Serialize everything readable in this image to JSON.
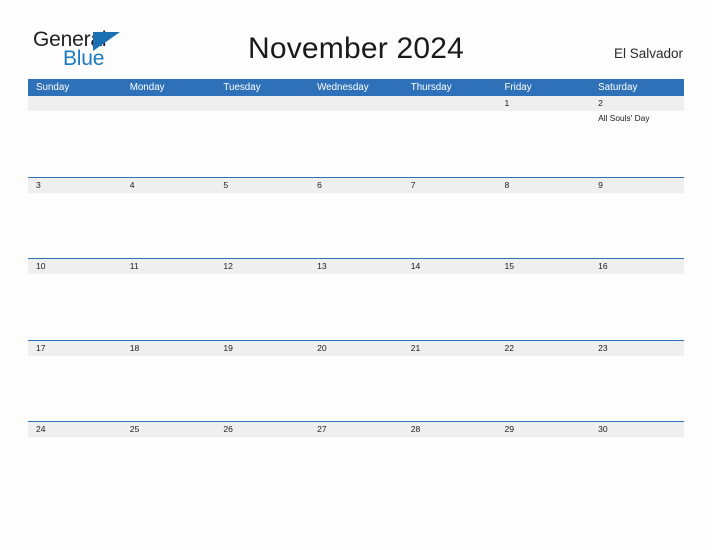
{
  "brand": {
    "name_part1": "General",
    "name_part2": "Blue"
  },
  "header": {
    "title": "November 2024",
    "country": "El Salvador"
  },
  "calendar": {
    "weekdays": [
      "Sunday",
      "Monday",
      "Tuesday",
      "Wednesday",
      "Thursday",
      "Friday",
      "Saturday"
    ],
    "colors": {
      "header_blue": "#2e71b8",
      "strip_gray": "#efefef",
      "brand_blue": "#1b7ac4",
      "page_background": "#fdfdfd"
    },
    "weeks": [
      {
        "days": [
          {
            "num": "",
            "events": []
          },
          {
            "num": "",
            "events": []
          },
          {
            "num": "",
            "events": []
          },
          {
            "num": "",
            "events": []
          },
          {
            "num": "",
            "events": []
          },
          {
            "num": "1",
            "events": []
          },
          {
            "num": "2",
            "events": [
              "All Souls' Day"
            ]
          }
        ]
      },
      {
        "days": [
          {
            "num": "3",
            "events": []
          },
          {
            "num": "4",
            "events": []
          },
          {
            "num": "5",
            "events": []
          },
          {
            "num": "6",
            "events": []
          },
          {
            "num": "7",
            "events": []
          },
          {
            "num": "8",
            "events": []
          },
          {
            "num": "9",
            "events": []
          }
        ]
      },
      {
        "days": [
          {
            "num": "10",
            "events": []
          },
          {
            "num": "11",
            "events": []
          },
          {
            "num": "12",
            "events": []
          },
          {
            "num": "13",
            "events": []
          },
          {
            "num": "14",
            "events": []
          },
          {
            "num": "15",
            "events": []
          },
          {
            "num": "16",
            "events": []
          }
        ]
      },
      {
        "days": [
          {
            "num": "17",
            "events": []
          },
          {
            "num": "18",
            "events": []
          },
          {
            "num": "19",
            "events": []
          },
          {
            "num": "20",
            "events": []
          },
          {
            "num": "21",
            "events": []
          },
          {
            "num": "22",
            "events": []
          },
          {
            "num": "23",
            "events": []
          }
        ]
      },
      {
        "days": [
          {
            "num": "24",
            "events": []
          },
          {
            "num": "25",
            "events": []
          },
          {
            "num": "26",
            "events": []
          },
          {
            "num": "27",
            "events": []
          },
          {
            "num": "28",
            "events": []
          },
          {
            "num": "29",
            "events": []
          },
          {
            "num": "30",
            "events": []
          }
        ]
      }
    ]
  }
}
